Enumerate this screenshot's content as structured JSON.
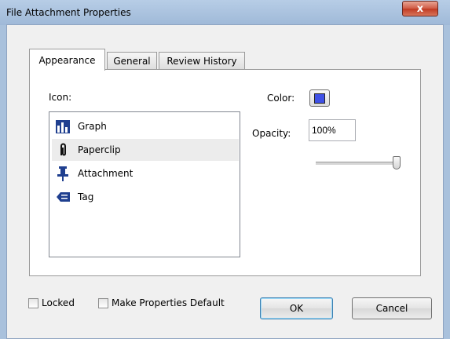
{
  "window": {
    "title": "File Attachment Properties",
    "close_glyph": "x"
  },
  "tabs": [
    {
      "label": "Appearance",
      "active": true
    },
    {
      "label": "General",
      "active": false
    },
    {
      "label": "Review History",
      "active": false
    }
  ],
  "appearance": {
    "icon_label": "Icon:",
    "icons": [
      {
        "label": "Graph",
        "icon": "graph-icon",
        "selected": false
      },
      {
        "label": "Paperclip",
        "icon": "paperclip-icon",
        "selected": true
      },
      {
        "label": "Attachment",
        "icon": "pushpin-icon",
        "selected": false
      },
      {
        "label": "Tag",
        "icon": "tag-icon",
        "selected": false
      }
    ],
    "color_label": "Color:",
    "color_value": "#3f51e6",
    "opacity_label": "Opacity:",
    "opacity_value": "100%",
    "opacity_slider_fraction": 1.0
  },
  "footer": {
    "locked_label": "Locked",
    "locked_checked": false,
    "make_default_label": "Make Properties Default",
    "make_default_checked": false,
    "ok_label": "OK",
    "cancel_label": "Cancel"
  }
}
